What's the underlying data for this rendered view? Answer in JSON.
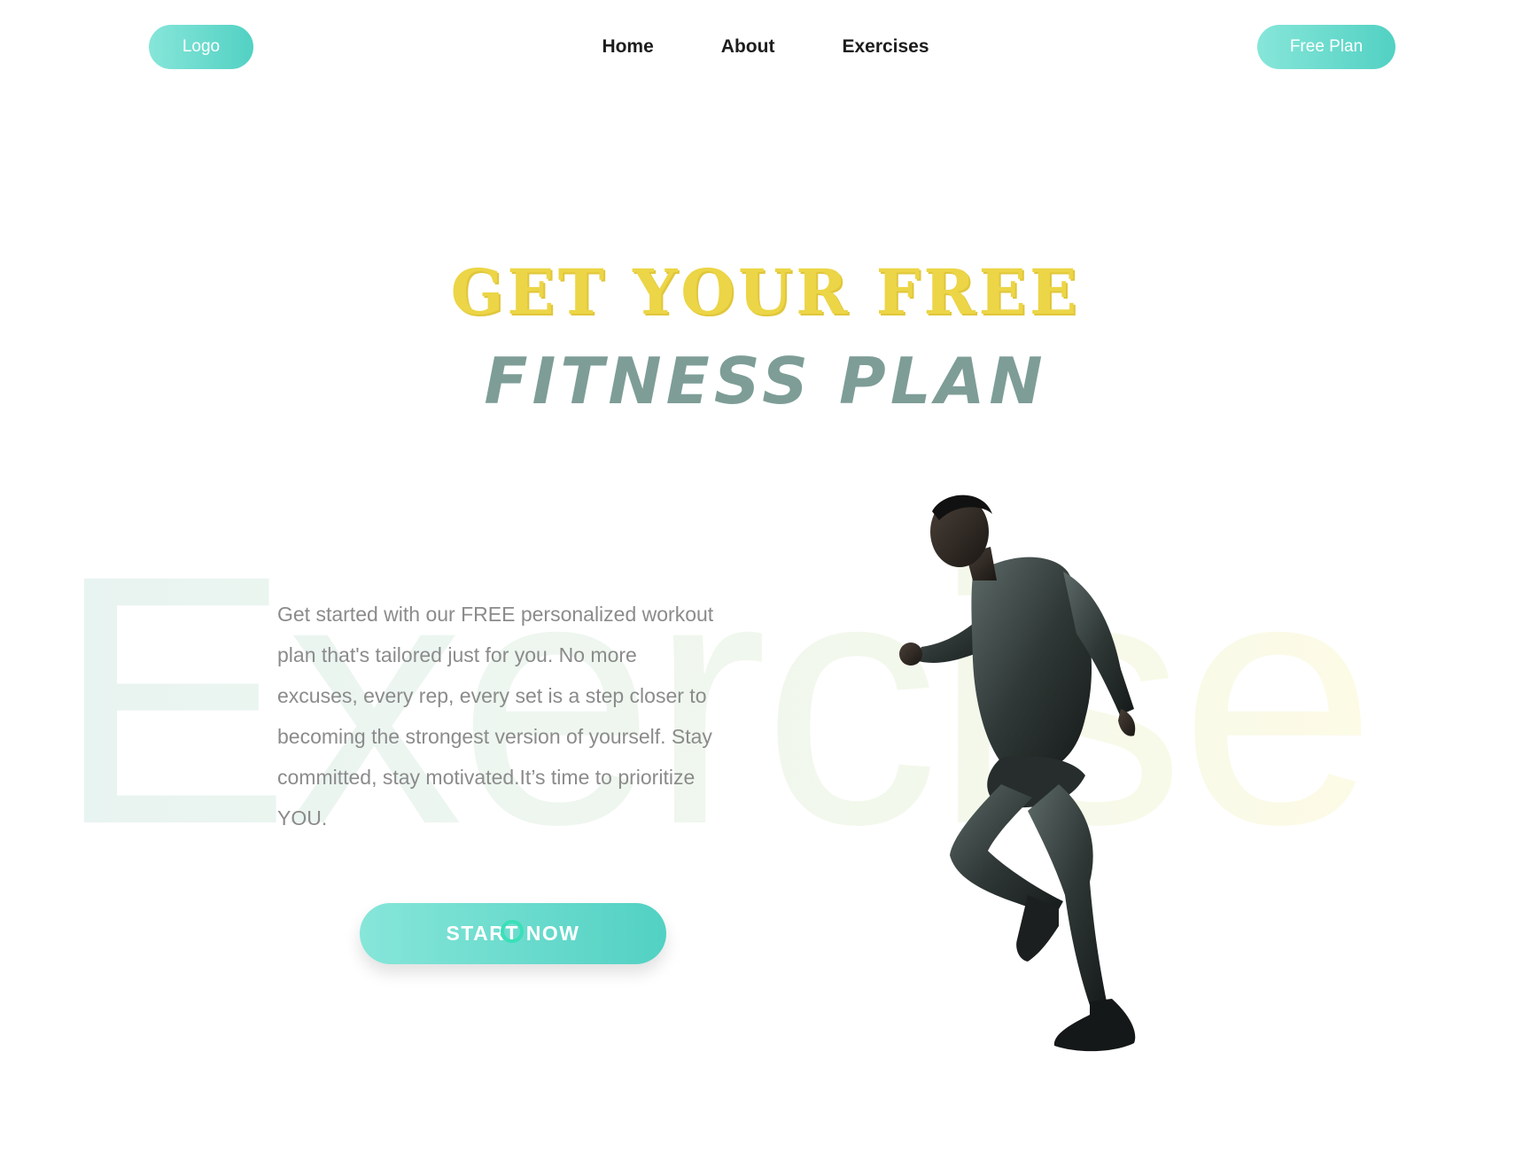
{
  "header": {
    "logo_label": "Logo",
    "nav": [
      {
        "label": "Home"
      },
      {
        "label": "About"
      },
      {
        "label": "Exercises"
      }
    ],
    "cta_label": "Free Plan"
  },
  "hero": {
    "title_line1": "GET YOUR FREE",
    "title_line2": "FITNESS PLAN",
    "background_word": "Exercise",
    "description": "Get started with our FREE personalized workout plan that's tailored just for you. No more excuses, every rep, every set is a step closer to becoming the strongest version of yourself. Stay committed, stay motivated.It’s time to prioritize YOU.",
    "button_label": "START NOW",
    "image_subject": "runner-silhouette"
  },
  "colors": {
    "accent_gradient_start": "#86e6d9",
    "accent_gradient_end": "#52d1c3",
    "title_yellow": "#ecd546",
    "title_slate": "#7e9d97",
    "body_text": "#8b8b8b"
  }
}
